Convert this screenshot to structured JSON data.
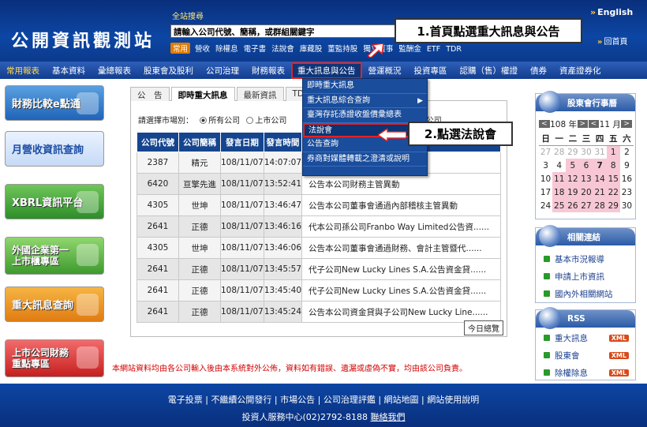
{
  "header": {
    "logo": "公開資訊觀測站",
    "search_title": "全站搜尋",
    "search_value": "請輸入公司代號、簡稱，或群組關鍵字",
    "common_badge": "常用",
    "quick_links": [
      "營收",
      "除權息",
      "電子書",
      "法說會",
      "庫藏股",
      "董監持股",
      "獨立董事",
      "監酬金",
      "ETF",
      "TDR"
    ],
    "english": "English",
    "home": "回首頁"
  },
  "callout1": "1.首頁點選重大訊息與公告",
  "callout2": "2.點選法說會",
  "nav": [
    "常用報表",
    "基本資料",
    "彙總報表",
    "股東會及股利",
    "公司治理",
    "財務報表",
    "重大訊息與公告",
    "營運概況",
    "投資專區",
    "認購（售）權證",
    "債券",
    "資產證券化"
  ],
  "sidebar": [
    "財務比較e點通",
    "月營收資訊查詢",
    "XBRL資訊平台",
    "外國企業第一上市櫃專區",
    "重大訊息查詢",
    "上市公司財務重點專區"
  ],
  "tabs": [
    "公　告",
    "即時重大訊息",
    "最新資訊",
    "TDR"
  ],
  "market": {
    "label": "請選擇市場別：",
    "options": [
      "所有公司",
      "上市公司",
      "發行公司"
    ]
  },
  "dropdown": [
    "即時重大訊息",
    "重大訊息綜合查詢",
    "臺灣存託憑證收盤價彙總表",
    "法說會",
    "公告查詢",
    "券商對媒體轉載之澄清或說明"
  ],
  "table": {
    "headers": [
      "公司代號",
      "公司簡稱",
      "發言日期",
      "發言時間",
      "主旨"
    ],
    "rows": [
      [
        "2387",
        "精元",
        "108/11/07",
        "14:07:07",
        ""
      ],
      [
        "6420",
        "亘擎先進",
        "108/11/07",
        "13:52:41",
        "公告本公司財務主管異動"
      ],
      [
        "4305",
        "世坤",
        "108/11/07",
        "13:46:47",
        "公告本公司董事會通過內部稽核主管異動"
      ],
      [
        "2641",
        "正德",
        "108/11/07",
        "13:46:16",
        "代本公司孫公司Franbo Way Limited公告資......"
      ],
      [
        "4305",
        "世坤",
        "108/11/07",
        "13:46:06",
        "公告本公司董事會通過財務、會計主管暨代......"
      ],
      [
        "2641",
        "正德",
        "108/11/07",
        "13:45:57",
        "代子公司New Lucky Lines S.A.公告資金貸......"
      ],
      [
        "2641",
        "正德",
        "108/11/07",
        "13:45:40",
        "代子公司New Lucky Lines S.A.公告資金貸......"
      ],
      [
        "2641",
        "正德",
        "108/11/07",
        "13:45:24",
        "公告本公司資金貸與子公司New Lucky Line......"
      ]
    ],
    "today_button": "今日總覽"
  },
  "calendar": {
    "title": "股東會行事曆",
    "year": "108 年",
    "month": "11 月",
    "prev": "<",
    "next": ">",
    "weekdays": [
      "日",
      "一",
      "二",
      "三",
      "四",
      "五",
      "六"
    ],
    "weeks": [
      [
        "27",
        "28",
        "29",
        "30",
        "31",
        "1",
        "2"
      ],
      [
        "3",
        "4",
        "5",
        "6",
        "7",
        "8",
        "9"
      ],
      [
        "10",
        "11",
        "12",
        "13",
        "14",
        "15",
        "16"
      ],
      [
        "17",
        "18",
        "19",
        "20",
        "21",
        "22",
        "23"
      ],
      [
        "24",
        "25",
        "26",
        "27",
        "28",
        "29",
        "30"
      ]
    ]
  },
  "related": {
    "title": "相關連結",
    "links": [
      "基本市況報導",
      "申請上市資訊",
      "國內外相關網站"
    ]
  },
  "rss": {
    "title": "RSS",
    "links": [
      "重大訊息",
      "股東會",
      "除權除息"
    ],
    "badge": "XML"
  },
  "disclaimer": "本網站資料均由各公司輸入後由本系統對外公佈，資料如有錯誤、遺漏或虛偽不實，均由該公司負責。",
  "footer": {
    "links": [
      "電子投票",
      "不繼續公開發行",
      "市場公告",
      "公司治理評鑑",
      "網站地圖",
      "網站使用說明"
    ],
    "contact": "投資人服務中心(02)2792-8188",
    "contact_link": "聯絡我們"
  },
  "colors": {
    "header": "#0c46a4",
    "highlight": "#e52121",
    "accent": "#ffcc33"
  }
}
